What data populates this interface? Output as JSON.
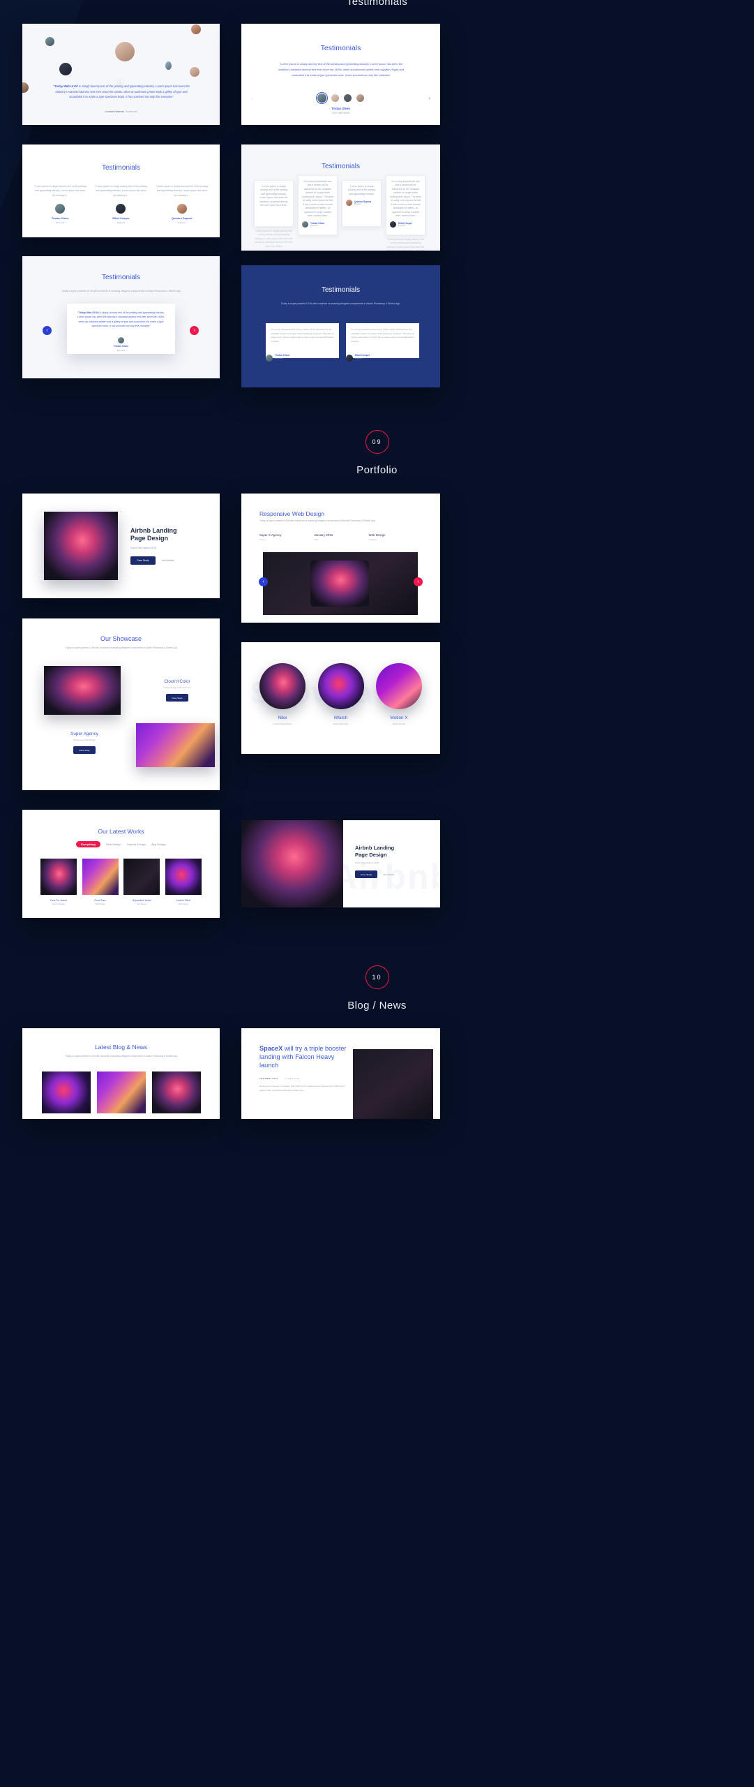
{
  "page": {
    "background": "#071027",
    "top_section_title": "Testimonials"
  },
  "accents": {
    "blue": "#3b5bdb",
    "deep_navy": "#1b2a6b",
    "crimson": "#ed1a4d",
    "card_navy": "#22397f"
  },
  "sections": [
    {
      "number": "09",
      "title": "Portfolio"
    },
    {
      "number": "10",
      "title": "Blog / News"
    }
  ],
  "testimonials": {
    "card1": {
      "quote_bold": "\"Today Web UI Kit",
      "quote": " is simply dummy text of the printing and typesetting industry. Lorem Ipsum has been the industry's standard dummy text ever since the 1500s, when an unknown printer took a galley of type and scrambled it to make a type specimen book. It has survived not only five centuries\"",
      "author": "Leonard Werner,",
      "company": "Facebook"
    },
    "card2": {
      "title": "Testimonials",
      "quote": "\"Lorem Ipsum is simply dummy text of the printing and typesetting industry. Lorem Ipsum has been the industry's standard dummy text ever since the 1500s, when an unknown printer took a galley of type and scrambled it to make a type specimen book. It has survived not only five centuries\"",
      "name": "Tristan Olsen",
      "role": "CEO Nike Street",
      "next_arrow": "›"
    },
    "card3": {
      "title": "Testimonials",
      "items": [
        {
          "quote": "\"Lorem Ipsum is simply dummy text of the printing and typesetting industry. Lorem Ipsum has been the industry's...",
          "name": "Tristan Olsen",
          "country": "Denmark"
        },
        {
          "quote": "\"Lorem Ipsum is simply dummy text of the printing and typesetting industry. Lorem Ipsum has been the industry's...",
          "name": "Elliot Cooper",
          "country": "England"
        },
        {
          "quote": "\"Lorem Ipsum is simply dummy text of the printing and typesetting industry. Lorem Ipsum has been the industry's...",
          "name": "Quinten Dupont",
          "country": "Belgium"
        }
      ]
    },
    "card4": {
      "title": "Testimonials",
      "items": [
        {
          "quote": "\"Lorem Ipsum is simply dummy text of the printing and typesetting industry. Lorem Ipsum has been the industry's standard dummy text ever since the 1500s.",
          "name": "",
          "country": ""
        },
        {
          "quote": "It is a long established fact that a reader will be distracted by the readable content of a page when looking at its layout. The point of using Lorem Ipsum is that it has a more-or-less normal distribution of letters, as opposed to using 'Content here, content here'.",
          "name": "Tristan Olsen",
          "country": "Denmark"
        },
        {
          "quote": "It is a long established fact that a reader will be distracted by the readable content of a page when looking at its layout. The point of using Lorem Ipsum is that it has a more-or-less normal distribution of letters, as opposed to using 'Content here, content here'.",
          "name": "Elliot Cooper",
          "country": "England"
        },
        {
          "quote": "\"Lorem Ipsum is simply dummy text of the printing and typesetting industry.",
          "name": "Quinten Dupont",
          "country": "Belgium"
        }
      ]
    },
    "card5": {
      "title": "Testimonials",
      "subtitle": "Today is super powerful UI kit with hundreds of amazing designed components in Adobe Photoshop & Sketch App.",
      "quote_bold": "\"Today Web UI Kit",
      "quote": " is simply dummy text of the printing and typesetting industry. Lorem Ipsum has been the industry's standard dummy text ever since the 1500s, when an unknown printer took a galley of type and scrambled it to make a type specimen book. It has survived not only five centuries\"",
      "name": "Tristan Olsen",
      "country": "Denmark",
      "prev": "‹",
      "next": "›"
    },
    "card6": {
      "title": "Testimonials",
      "subtitle": "Today is super powerful UI kit with hundreds of amazing designed components in Adobe Photoshop & Sketch App.",
      "items": [
        {
          "quote": "It is a long established fact that a reader will be distracted by the readable content of a page when looking at its layout. The point of using Lorem Ipsum is that it has a more-or-less normal distribution of letters.",
          "name": "Tristan Olsen",
          "country": "Denmark"
        },
        {
          "quote": "It is a long established fact that a reader will be distracted by the readable content of a page when looking at its layout. The point of using Lorem Ipsum is that it has a more-or-less normal distribution of letters.",
          "name": "Elliot Cooper",
          "country": "England"
        }
      ]
    }
  },
  "portfolio": {
    "card1": {
      "title": "Airbnb Landing\nPage Design",
      "meta": "Super Style Agency 2018",
      "button": "Case Study",
      "link": "Visit Website"
    },
    "card2": {
      "title": "Responsive Web Design",
      "subtitle": "Today is super powerful UI kit with hundreds of amazing designed components in Adobe Photoshop & Sketch App.",
      "meta": [
        {
          "label": "Super X Agency",
          "value": "Client"
        },
        {
          "label": "January 2018",
          "value": "Date"
        },
        {
          "label": "Web Design",
          "value": "Category"
        }
      ],
      "prev": "‹",
      "next": "›"
    },
    "card3": {
      "title": "Our Showcase",
      "subtitle": "Today is super powerful UI kit with hundreds of amazing designed components in Adobe Photoshop & Sketch App.",
      "items": [
        {
          "title": "Clock'n'Color",
          "sub": "UI/App Design & Development",
          "button": "Case Study"
        },
        {
          "title": "Super Agency",
          "sub": "Responsive Web Design",
          "button": "Case Study"
        }
      ]
    },
    "card4": {
      "items": [
        {
          "title": "Nike",
          "sub": "Landing Page Design"
        },
        {
          "title": "iWatch",
          "sub": "Apple Watch App"
        },
        {
          "title": "Motion X",
          "sub": "Motion Design"
        }
      ],
      "ghost": "Showcase"
    },
    "card5": {
      "title": "Our Latest Works",
      "filters": [
        "Everything",
        "Web Design",
        "Graphic Design",
        "App Design"
      ],
      "items": [
        {
          "title": "Faux Fur Jacket",
          "sub": "Graphic Design"
        },
        {
          "title": "Floral Faux",
          "sub": "Web Design"
        },
        {
          "title": "Bejewelled Jacket",
          "sub": "App Design"
        },
        {
          "title": "Leather Effect",
          "sub": "Web Design"
        }
      ]
    },
    "card6": {
      "title": "Airbnb Landing\nPage Design",
      "meta": "Super Style Agency 2018",
      "button": "Case Study",
      "link": "Visit Website",
      "ghost": "Airbnb"
    }
  },
  "blog": {
    "card1": {
      "title": "Latest Blog & News",
      "subtitle": "Today is super powerful UI kit with hundreds of amazing designed components in Adobe Photoshop & Sketch App."
    },
    "card2": {
      "title_bold": "SpaceX",
      "title_rest": " will try a triple booster landing with Falcon Heavy launch",
      "category": "TECHNOLOGY",
      "date": "13 FEB 2018",
      "body": "Dress with crossover V-neckline with ruffled trims. Features long sleeves with ruffled trims, elastic cuffs, a cinched waist and a ruffled hem."
    }
  }
}
